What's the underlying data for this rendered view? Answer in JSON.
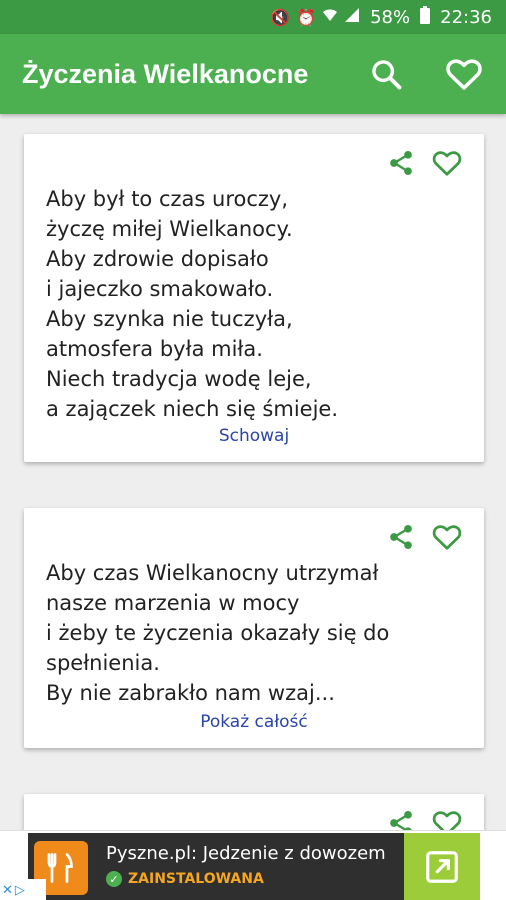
{
  "status_bar": {
    "battery": "58%",
    "time": "22:36",
    "icons": [
      "mute-icon",
      "alarm-icon",
      "wifi-icon",
      "signal-icon",
      "battery-icon"
    ]
  },
  "app_bar": {
    "title": "Życzenia Wielkanocne",
    "actions": [
      "search-icon",
      "heart-icon"
    ]
  },
  "cards": [
    {
      "text": "Aby był to czas uroczy,\nżyczę miłej Wielkanocy.\nAby zdrowie dopisało\ni jajeczko smakowało.\nAby szynka nie tuczyła,\natmosfera była miła.\nNiech tradycja wodę leje,\na zajączek niech się śmieje.",
      "link": "Schowaj"
    },
    {
      "text": "Aby czas Wielkanocny utrzymał\nnasze marzenia w mocy\ni żeby te życzenia okazały się do\nspełnienia.\nBy nie zabrakło nam wzaj...",
      "link": "Pokaż całość"
    }
  ],
  "ad": {
    "title": "Pyszne.pl: Jedzenie z dowozem",
    "status": "ZAINSTALOWANA",
    "colors": {
      "logo": "#f08a1a",
      "open": "#9ccc3a",
      "status": "#f5a623"
    }
  },
  "colors": {
    "app_bar": "#4caf50",
    "status_bar": "#3d9a44",
    "accent": "#3d9a44",
    "link": "#2a44a8"
  }
}
